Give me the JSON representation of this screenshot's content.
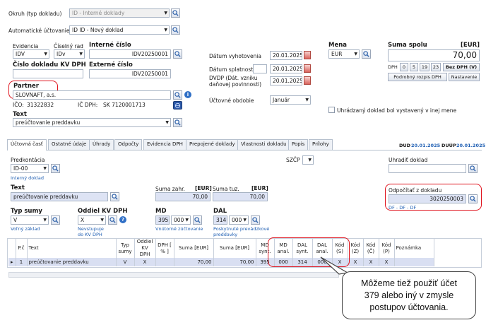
{
  "header": {
    "okruh_label": "Okruh (typ dokladu)",
    "okruh_value": "ID - Interné doklady",
    "auto_label": "Automatické účtovanie",
    "auto_value": "ID ID - Nový doklad",
    "evidencia_label": "Evidencia",
    "evidencia_value": "IDV",
    "ciselny_label": "Číselný rad",
    "ciselny_value": "IDv",
    "interne_label": "Interné číslo",
    "interne_value": "IDV20250001",
    "cislo_kv_label": "Číslo dokladu KV DPH",
    "cislo_kv_value": "",
    "externe_label": "Externé číslo",
    "externe_value": "IDV20250001",
    "partner_label": "Partner",
    "partner_value": "SLOVNAFT, a.s.",
    "ico_label": "IČO:",
    "ico_value": "31322832",
    "icdph_label": "IČ DPH:",
    "icdph_value": "SK 7120001713",
    "text_label": "Text",
    "text_value": "preúčtovanie preddavku",
    "datum_vyhot_label": "Dátum vyhotovenia",
    "datum_vyhot_value": "20.01.2025",
    "datum_splat_label": "Dátum splatnosti",
    "datum_splat_value": "20.01.2025",
    "dvdp_label_1": "DVDP (Dát. vzniku",
    "dvdp_label_2": "daňovej povinnosti)",
    "dvdp_value": "20.01.2025",
    "obdobie_label": "Účtovné obdobie",
    "obdobie_value": "Január",
    "mena_label": "Mena",
    "mena_value": "EUR",
    "suma_label": "Suma spolu",
    "suma_unit": "[EUR]",
    "suma_value": "70,00",
    "dph_label": "DPH",
    "dph_rates": [
      "0",
      "5",
      "19",
      "23"
    ],
    "bez_dph": "Bez DPH (V)",
    "rozpis_btn": "Podrobný rozpis DPH",
    "nastavenie_btn": "Nastavenie",
    "uhradzany_label": "Uhrádzaný doklad bol vystavený v inej mene"
  },
  "tabs": [
    "Účtovná časť",
    "Ostatné údaje",
    "Úhrady",
    "Odpočty",
    "Evidencia DPH",
    "Prepojené doklady",
    "Vlastnosti dokladu",
    "Popis",
    "Prílohy"
  ],
  "dates_right": {
    "dud_label": "DUD",
    "dud_value": "20.01.2025",
    "duup_label": "DUÚP",
    "duup_value": "20.01.2025"
  },
  "lower": {
    "predkontacia_label": "Predkontácia",
    "predkontacia_value": "ID-00",
    "interny_doklad": "Interný doklad",
    "szcp_label": "SZČP",
    "uhradit_label": "Uhradiť doklad",
    "uhradit_value": "",
    "text_label": "Text",
    "text_value": "preúčtovanie preddavku",
    "suma_zahr_label": "Suma zahr.",
    "suma_zahr_unit": "[EUR]",
    "suma_zahr_value": "70,00",
    "suma_tuz_label": "Suma tuz.",
    "suma_tuz_unit": "[EUR]",
    "suma_tuz_value": "70,00",
    "odpocitat_label": "Odpočítať z dokladu",
    "odpocitat_value": "3020250003",
    "odpocitat_link": "DF - DF - DF",
    "typ_sumy_label": "Typ sumy",
    "typ_sumy_value": "V",
    "volny_zaklad": "Voľný základ",
    "oddiel_label": "Oddiel KV DPH",
    "oddiel_value": "X",
    "nevstupuje_1": "Nevstupuje",
    "nevstupuje_2": "do KV DPH",
    "md_label": "MD",
    "md_ucet": "395",
    "md_anal": "000",
    "vnutorne": "Vnútorné zúčtovanie",
    "dal_label": "DAL",
    "dal_ucet": "314",
    "dal_anal": "000",
    "poskytnute_1": "Poskytnuté prevádzkové",
    "poskytnute_2": "preddavky"
  },
  "grid": {
    "headers": [
      "P.č",
      "Text",
      "Typ sumy",
      "Oddiel KV DPH",
      "DPH [ % ]",
      "Suma [EUR]",
      "Suma [EUR]",
      "MD synt.",
      "MD anal.",
      "DAL synt.",
      "DAL anal.",
      "Kód (S)",
      "Kód (Z)",
      "Kód (Č)",
      "Kód (P)",
      "Poznámka"
    ],
    "rows": [
      [
        "1",
        "preúčtovanie preddavku",
        "V",
        "X",
        "",
        "70,00",
        "70,00",
        "395",
        "000",
        "314",
        "000",
        "X",
        "X",
        "X",
        "X",
        ""
      ]
    ]
  },
  "callout": {
    "line1": "Môžeme tiež použiť účet",
    "line2": "379 alebo iný v zmysle",
    "line3": "postupov účtovania."
  },
  "colors": {
    "highlight_red": "#e0141e",
    "link_blue": "#1f5fb3",
    "selected_row": "#d9dff2"
  }
}
